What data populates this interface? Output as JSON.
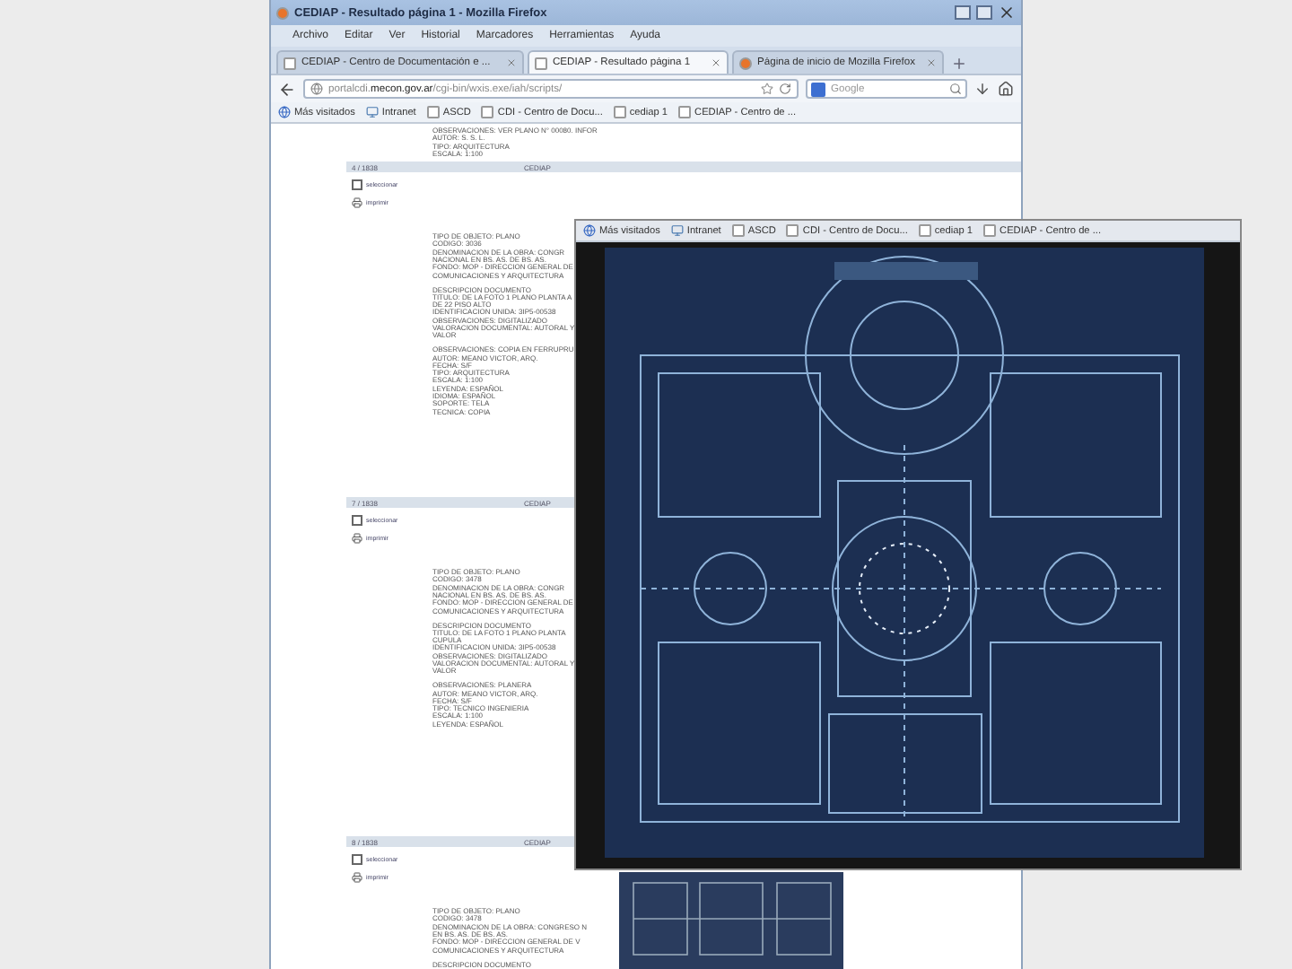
{
  "browser": {
    "title": "CEDIAP - Resultado página 1 - Mozilla Firefox",
    "menu": [
      "Archivo",
      "Editar",
      "Ver",
      "Historial",
      "Marcadores",
      "Herramientas",
      "Ayuda"
    ],
    "tabs": [
      {
        "label": "CEDIAP - Centro de Documentación e ...",
        "selected": false,
        "kind": "page"
      },
      {
        "label": "CEDIAP - Resultado página 1",
        "selected": true,
        "kind": "page"
      },
      {
        "label": "Página de inicio de Mozilla Firefox",
        "selected": false,
        "kind": "firefox"
      }
    ],
    "url": "portalcdi.**mecon.gov.ar**/cgi-bin/wxis.exe/iah/scripts/",
    "search_placeholder": "Google",
    "bookmarks": [
      {
        "label": "Más visitados",
        "kind": "most-visited"
      },
      {
        "label": "Intranet",
        "kind": "intranet"
      },
      {
        "label": "ASCD",
        "kind": "page"
      },
      {
        "label": "CDI - Centro de Docu...",
        "kind": "page"
      },
      {
        "label": "cediap 1",
        "kind": "page"
      },
      {
        "label": "CEDIAP - Centro de ...",
        "kind": "page"
      }
    ]
  },
  "leading_lines": [
    "OBSERVACIONES: VER PLANO N° 00080. INFOR",
    "AUTOR: S. S. L.",
    "TIPO: ARQUITECTURA",
    "ESCALA: 1:100"
  ],
  "records": [
    {
      "number": "4 / 1838",
      "source": "CEDIAP",
      "selected": false,
      "select_label": "seleccionar",
      "print_label": "imprimir",
      "groups": [
        [
          "TIPO DE OBJETO: PLANO",
          "CODIGO: 3036",
          "DENOMINACION DE LA OBRA: CONGR",
          "NACIONAL EN BS. AS. DE BS. AS.",
          "FONDO: MOP - DIRECCION GENERAL DE",
          "COMUNICACIONES Y ARQUITECTURA"
        ],
        [
          "DESCRIPCION DOCUMENTO",
          "TITULO: DE LA FOTO 1 PLANO PLANTA A",
          "DE 22 PISO ALTO",
          "IDENTIFICACION UNIDA: 3IP5-00538",
          "OBSERVACIONES: DIGITALIZADO",
          "VALORACION DOCUMENTAL: AUTORAL Y",
          "VALOR"
        ],
        [
          "OBSERVACIONES: COPIA EN FERRUPRU",
          "AUTOR: MEANO VICTOR, ARQ.",
          "FECHA: S/F",
          "TIPO: ARQUITECTURA",
          "ESCALA: 1:100",
          "LEYENDA: ESPAÑOL",
          "IDIOMA: ESPAÑOL",
          "SOPORTE: TELA",
          "TECNICA: COPIA"
        ]
      ]
    },
    {
      "number": "7 / 1838",
      "source": "CEDIAP",
      "selected": false,
      "select_label": "seleccionar",
      "print_label": "imprimir",
      "groups": [
        [
          "TIPO DE OBJETO: PLANO",
          "CODIGO: 3478",
          "DENOMINACION DE LA OBRA: CONGR",
          "NACIONAL EN BS. AS. DE BS. AS.",
          "FONDO: MOP - DIRECCION GENERAL DE",
          "COMUNICACIONES Y ARQUITECTURA"
        ],
        [
          "DESCRIPCION DOCUMENTO",
          "TITULO: DE LA FOTO 1 PLANO PLANTA",
          "CUPULA",
          "IDENTIFICACION UNIDA: 3IP5-00538",
          "OBSERVACIONES: DIGITALIZADO",
          "VALORACION DOCUMENTAL: AUTORAL Y",
          "VALOR"
        ],
        [
          "OBSERVACIONES: PLANERA",
          "AUTOR: MEANO VICTOR, ARQ.",
          "FECHA: S/F",
          "TIPO: TECNICO INGENIERIA",
          "ESCALA: 1:100",
          "LEYENDA: ESPAÑOL"
        ]
      ]
    },
    {
      "number": "8 / 1838",
      "source": "CEDIAP",
      "selected": false,
      "select_label": "seleccionar",
      "print_label": "imprimir",
      "groups": [
        [
          "TIPO DE OBJETO: PLANO",
          "CODIGO: 3478",
          "DENOMINACION DE LA OBRA: CONGRESO N",
          "EN BS. AS. DE BS. AS.",
          "FONDO: MOP - DIRECCION GENERAL DE V",
          "COMUNICACIONES Y ARQUITECTURA"
        ],
        [
          "DESCRIPCION DOCUMENTO"
        ]
      ]
    }
  ],
  "overlay": {
    "bookmarks": [
      {
        "label": "Más visitados",
        "kind": "most-visited"
      },
      {
        "label": "Intranet",
        "kind": "intranet"
      },
      {
        "label": "ASCD",
        "kind": "page"
      },
      {
        "label": "CDI - Centro de Docu...",
        "kind": "page"
      },
      {
        "label": "cediap 1",
        "kind": "page"
      },
      {
        "label": "CEDIAP - Centro de ...",
        "kind": "page"
      }
    ]
  }
}
